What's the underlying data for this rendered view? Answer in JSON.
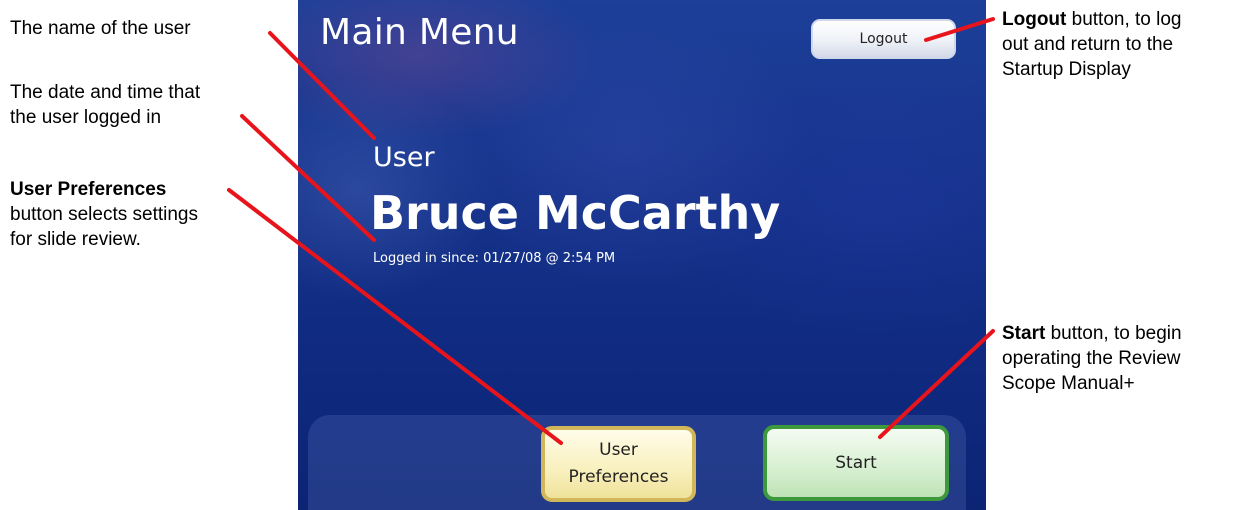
{
  "screen": {
    "title": "Main Menu",
    "logout_label": "Logout",
    "user_label": "User",
    "user_name": "Bruce McCarthy",
    "logged_in_text": "Logged in since: 01/27/08 @ 2:54 PM",
    "prefs_label_line1": "User",
    "prefs_label_line2": "Preferences",
    "start_label": "Start"
  },
  "annotations": {
    "user_name": "The name of the user",
    "login_time_line1": "The date and time that",
    "login_time_line2": "the user logged in",
    "prefs_bold": "User Preferences",
    "prefs_line2": "button selects settings",
    "prefs_line3": "for slide review.",
    "logout_bold": "Logout",
    "logout_rest": " button, to log",
    "logout_line2": "out and return to the",
    "logout_line3": "Startup Display",
    "start_bold": "Start",
    "start_rest": " button, to begin",
    "start_line2": "operating the Review",
    "start_line3": "Scope Manual+"
  },
  "colors": {
    "leader_line": "#e8141c",
    "screen_background": "#16338b",
    "prefs_border": "#d2b75a",
    "start_border": "#3c9a3c"
  }
}
